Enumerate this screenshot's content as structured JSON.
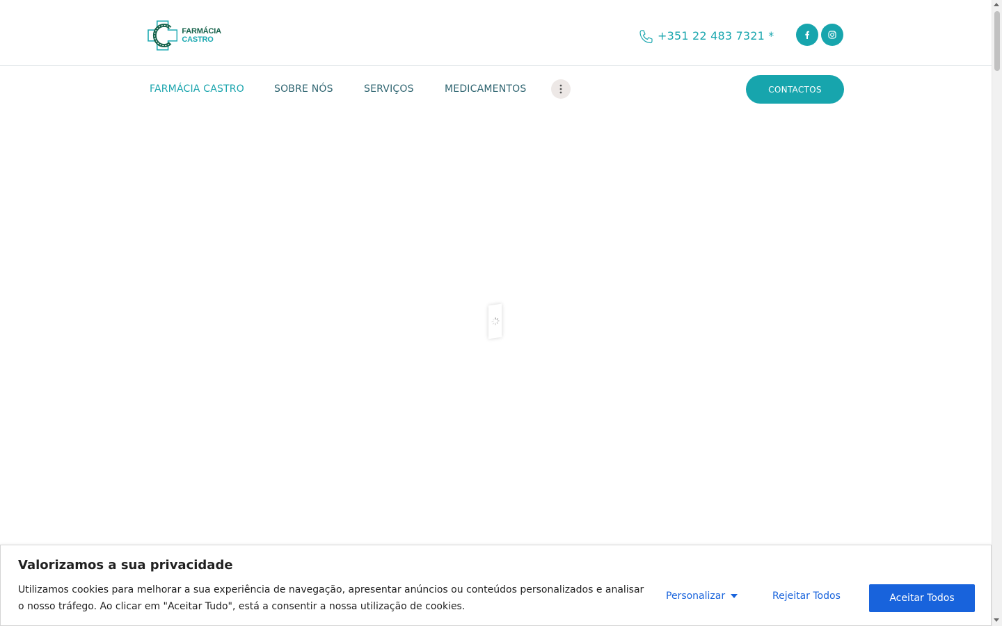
{
  "brand": {
    "logo_word1": "FARMÁCIA",
    "logo_word2": "CASTRO",
    "primary_color": "#17a5ad",
    "dark_green": "#14614a"
  },
  "header": {
    "phone": "+351 22 483 7321 *",
    "phone_icon": "phone-icon",
    "social": [
      {
        "name": "facebook-icon"
      },
      {
        "name": "instagram-icon"
      }
    ]
  },
  "nav": {
    "items": [
      {
        "label": "FARMÁCIA CASTRO",
        "active": true
      },
      {
        "label": "SOBRE NÓS",
        "active": false
      },
      {
        "label": "SERVIÇOS",
        "active": false
      },
      {
        "label": "MEDICAMENTOS",
        "active": false
      }
    ],
    "more_icon": "vertical-dots-icon",
    "contact_label": "CONTACTOS"
  },
  "cookie_banner": {
    "title": "Valorizamos a sua privacidade",
    "text": "Utilizamos cookies para melhorar a sua experiência de navegação, apresentar anúncios ou conteúdos personalizados e analisar o nosso tráfego. Ao clicar em \"Aceitar Tudo\", está a consentir a nossa utilização de cookies.",
    "customize_label": "Personalizar",
    "reject_label": "Rejeitar Todos",
    "accept_label": "Aceitar Todos",
    "accent_color": "#1863dc"
  }
}
